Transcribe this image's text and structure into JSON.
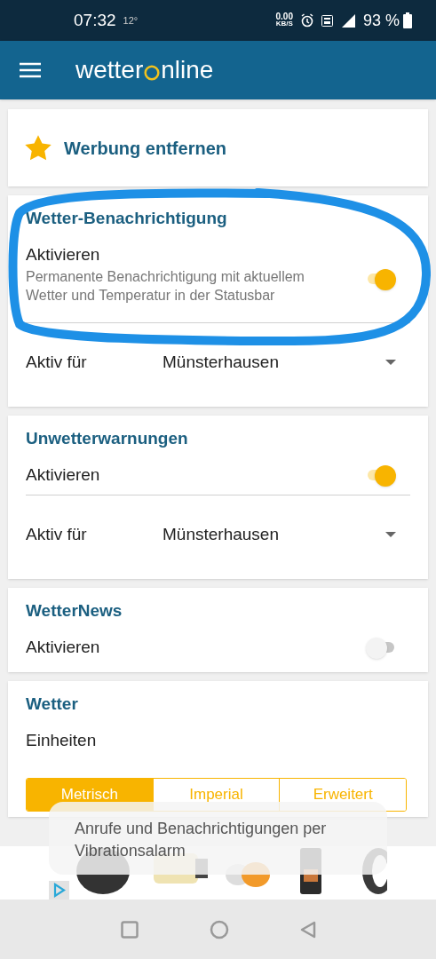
{
  "status_bar": {
    "time": "07:32",
    "temperature": "12°",
    "data_rate": "0.00",
    "data_unit": "KB/S",
    "battery": "93 %"
  },
  "app_bar": {
    "logo_before": "wetter",
    "logo_after": "nline"
  },
  "promo": {
    "label": "Werbung entfernen"
  },
  "sections": [
    {
      "title": "Wetter-Benachrichtigung",
      "rows": [
        {
          "kind": "switch",
          "label": "Aktivieren",
          "description": "Permanente Benachrichtigung mit aktuellem Wetter und Temperatur in der Statusbar",
          "on": true
        },
        {
          "kind": "dropdown",
          "label": "Aktiv für",
          "value": "Münsterhausen"
        }
      ]
    },
    {
      "title": "Unwetterwarnungen",
      "rows": [
        {
          "kind": "switch",
          "label": "Aktivieren",
          "on": true
        },
        {
          "kind": "dropdown",
          "label": "Aktiv für",
          "value": "Münsterhausen"
        }
      ]
    },
    {
      "title": "WetterNews",
      "rows": [
        {
          "kind": "switch",
          "label": "Aktivieren",
          "on": false
        }
      ]
    },
    {
      "title": "Wetter",
      "rows": [
        {
          "kind": "heading",
          "label": "Einheiten"
        },
        {
          "kind": "segmented",
          "options": [
            {
              "label": "Metrisch",
              "selected": true
            },
            {
              "label": "Imperial",
              "selected": false
            },
            {
              "label": "Erweitert",
              "selected": false
            }
          ]
        }
      ]
    }
  ],
  "toast": {
    "text": "Anrufe und Benachrichtigungen per Vibrationsalarm"
  },
  "annotation": {
    "kind": "ellipse"
  }
}
